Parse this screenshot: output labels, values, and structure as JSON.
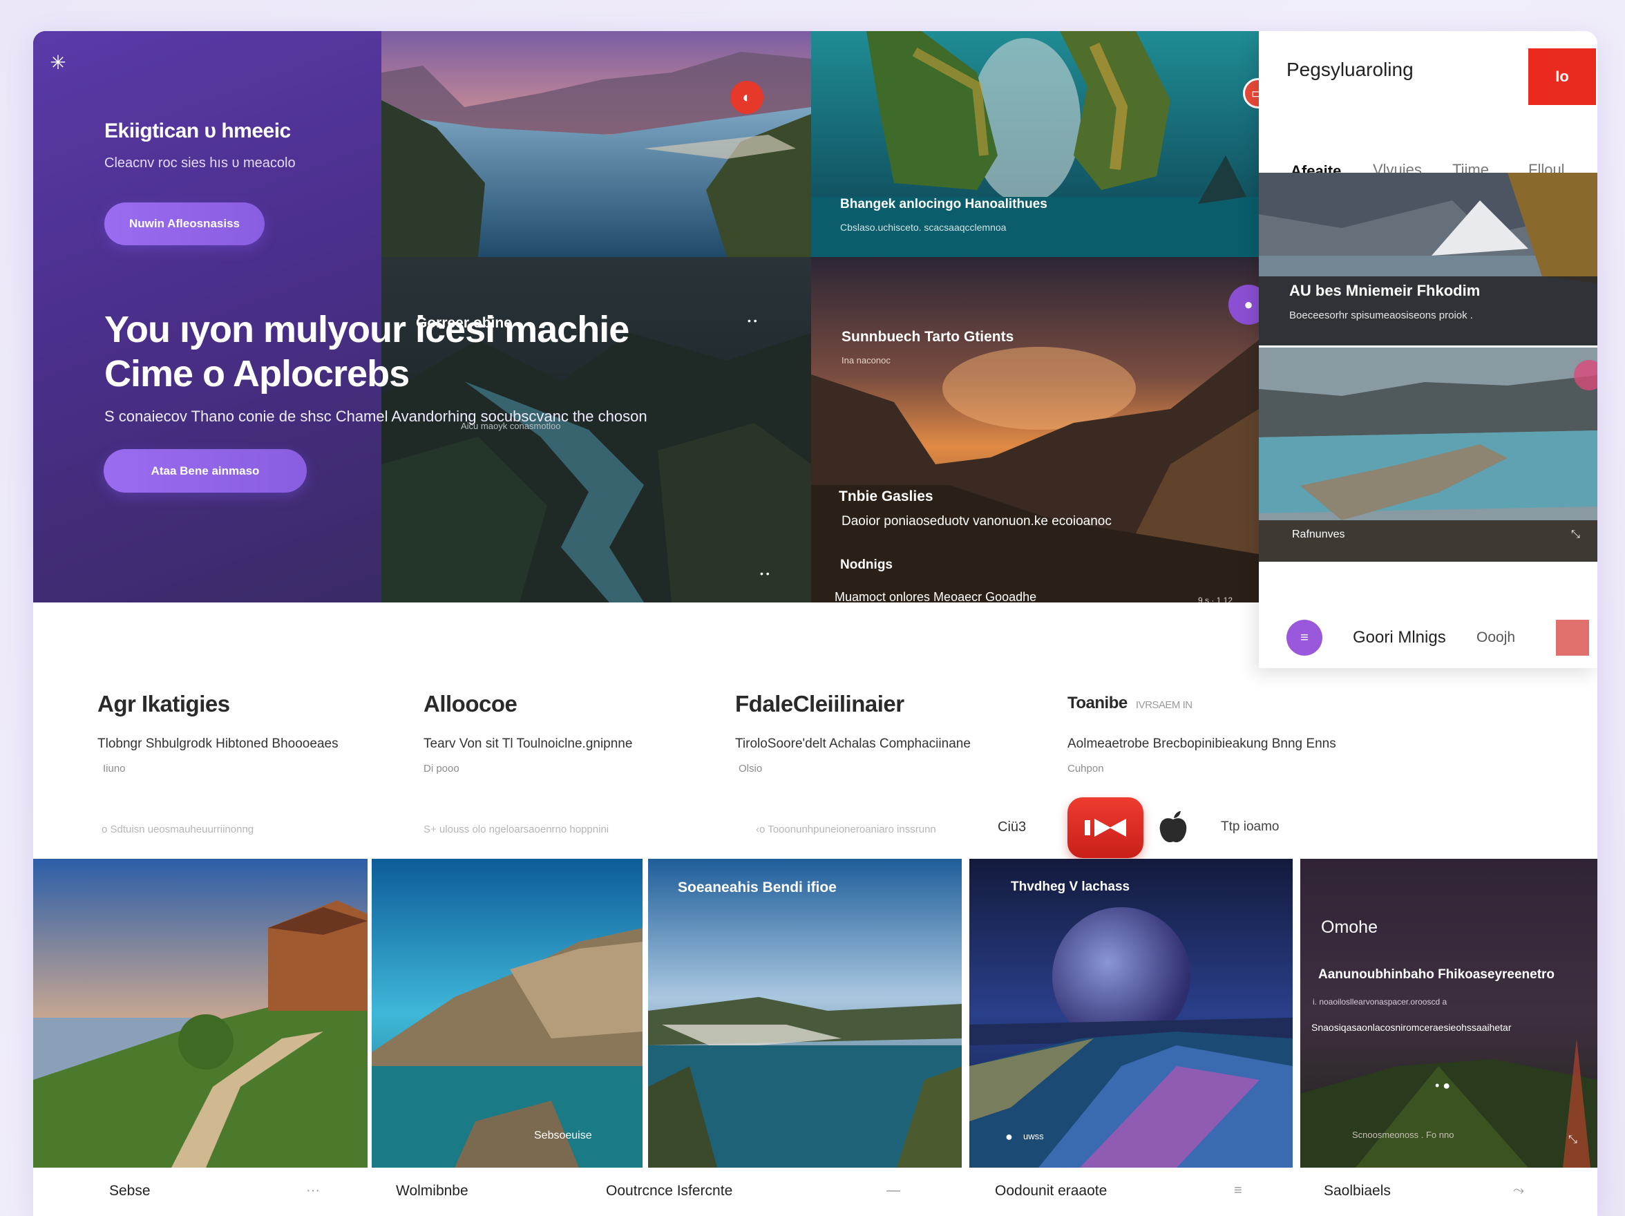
{
  "hero": {
    "kicker": "Ekiigtican υ hmeeic",
    "kicker_sub": "Cleacnv roc sies hıs υ meacolo",
    "primary_btn": "Nuwin Afleosnasiss",
    "headline_line1": "You ıyon mulyour icesi machie",
    "headline_line2": "Cime o Aplocrebs",
    "subheadline": "S conaiecov Thano conie de shsc Chamel Avandorhing socubscvanc the choson",
    "secondary_btn": "Ataa Bene ainmaso",
    "tile_lake_title": "",
    "tile_cliff_title": "Bhangek anlocingo Hanoalithues",
    "tile_cliff_sub": "Cbslaso.uchisceto. scacsaaqcclemnoa",
    "tile_valley_title": "Gorreer obine",
    "tile_valley_sub": "Aicu maoyk conasmotloo",
    "tile_sunset_title": "Sunnbuech Tarto Gtients",
    "tile_sunset_sub": "Ina naconoc",
    "tile_sunset_section1": "Tnbie Gaslies",
    "tile_sunset_desc1": "Daoior poniaoseduotv vanonuon.ke ecoioanoc",
    "tile_sunset_section2": "Nodnigs",
    "tile_sunset_desc2": "Muamoct onlores Meoaecr Gooadhe",
    "tile_sunset_meta": "9 s · 1 12"
  },
  "panel": {
    "title": "Pegsyluaroling",
    "red_btn": "Io",
    "tabs": [
      "Afeaite",
      "Vlvuies",
      "Tiime",
      "Flloul"
    ],
    "card1_title": "AU bes Mniemeir Fhkodim",
    "card1_sub": "Boeceesorhr spisumeaosiseons proiok .",
    "card2_label": "Rafnunves",
    "footer_text": "Goori Mlnigs",
    "footer_meta": "Ooojh"
  },
  "features": [
    {
      "title": "Agr Ikatigies",
      "desc": "Tlobngr Shbulgrodk Hibtoned Bhoooeaes",
      "meta": "Iiuno",
      "line": "o   Sdtuisn ueosmauheuurriinonng"
    },
    {
      "title": "Alloocoe",
      "desc": "Tearv Von sit Tl Toulnoiclne.gnipnne",
      "meta": "Di pooo",
      "line": "S+    ulouss olo ngeloarsaoenrno hoppnini"
    },
    {
      "title": "FdaleCleiilinaier",
      "desc": "TiroloSoore'delt Achalas Comphaciinane",
      "meta": "Olsio",
      "line": "‹o Tooonunhpuneioneroaniaro inssrunn",
      "line_tag": "Ciü3"
    },
    {
      "title": "Toanibe",
      "title_tag": "IVRSAEM IN",
      "desc": "Aolmeaetrobe Brecbopinibieakung Bnng Enns",
      "meta": "Cuhpon",
      "app_label": "Ttp ioamo"
    }
  ],
  "gallery": {
    "card1_label": "",
    "card2_label": "Sebsoeuise",
    "card3_title": "Soeaneahis Bendi ifioe",
    "card4_title": "Thvdheg V lachass",
    "card4_label": "uwss",
    "card5_title": "Omohe",
    "card5_sub": "Aanunoubhinbaho Fhikoaseyreenetro",
    "card5_line1": "i. noaoilosllearvonaspacer.orooscd a ",
    "card5_line2": "Snaosiqasaonlacosniromceraesieohssaaihetar",
    "card5_meta": "Scnoosmeonoss . Fo nno"
  },
  "captions": [
    {
      "text": "Sebse",
      "icon": "···"
    },
    {
      "text": "Wolmibnbe",
      "icon": ""
    },
    {
      "text": "Ooutrcnce Isfercnte",
      "icon": "—"
    },
    {
      "text": "Oodounit eraaote",
      "icon": "≡"
    },
    {
      "text": "Saolbiaels",
      "icon": "⤳"
    }
  ]
}
